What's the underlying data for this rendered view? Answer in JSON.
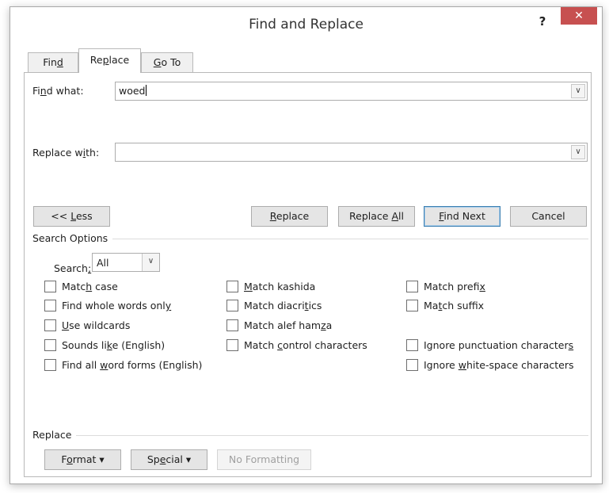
{
  "window": {
    "title": "Find and Replace",
    "help_label": "?",
    "close_label": "✕"
  },
  "tabs": [
    {
      "pre": "Fin",
      "key": "d",
      "post": "",
      "active": false
    },
    {
      "pre": "Re",
      "key": "p",
      "post": "lace",
      "active": true
    },
    {
      "pre": "",
      "key": "G",
      "post": "o To",
      "active": false
    }
  ],
  "find": {
    "label_pre": "Fi",
    "label_key": "n",
    "label_post": "d what:",
    "value": "woed"
  },
  "replace": {
    "label_pre": "Replace w",
    "label_key": "i",
    "label_post": "th:",
    "value": ""
  },
  "buttons": {
    "less": {
      "pre": "<< ",
      "key": "L",
      "post": "ess"
    },
    "replace": {
      "pre": "",
      "key": "R",
      "post": "eplace"
    },
    "replace_all": {
      "pre": "Replace ",
      "key": "A",
      "post": "ll"
    },
    "find_next": {
      "pre": "",
      "key": "F",
      "post": "ind Next"
    },
    "cancel": "Cancel"
  },
  "search_options": {
    "heading": "Search Options",
    "search_label_pre": "Search",
    "search_label_key": ";",
    "search_label_post": "",
    "search_value": "All",
    "checkboxes": [
      {
        "pre": "Matc",
        "key": "h",
        "post": " case",
        "checked": false
      },
      {
        "pre": "Find whole words onl",
        "key": "y",
        "post": "",
        "checked": false
      },
      {
        "pre": "",
        "key": "U",
        "post": "se wildcards",
        "checked": false
      },
      {
        "pre": "Sounds li",
        "key": "k",
        "post": "e (English)",
        "checked": false
      },
      {
        "pre": "Find all ",
        "key": "w",
        "post": "ord forms (English)",
        "checked": false
      },
      {
        "pre": "",
        "key": "M",
        "post": "atch kashida",
        "checked": false
      },
      {
        "pre": "Match diacri",
        "key": "t",
        "post": "ics",
        "checked": false
      },
      {
        "pre": "Match alef ham",
        "key": "z",
        "post": "a",
        "checked": false
      },
      {
        "pre": "Match ",
        "key": "c",
        "post": "ontrol characters",
        "checked": false
      },
      {
        "pre": "Match prefi",
        "key": "x",
        "post": "",
        "checked": false
      },
      {
        "pre": "Ma",
        "key": "t",
        "post": "ch suffix",
        "checked": false
      },
      {
        "pre": "Ignore punctuation character",
        "key": "s",
        "post": "",
        "checked": false
      },
      {
        "pre": "Ignore ",
        "key": "w",
        "post": "hite-space characters",
        "checked": false
      }
    ]
  },
  "replace_section": {
    "heading": "Replace",
    "format": {
      "pre": "F",
      "key": "o",
      "post": "rmat ▾"
    },
    "special": {
      "pre": "Sp",
      "key": "e",
      "post": "cial ▾"
    },
    "no_formatting": "No Formatting"
  }
}
